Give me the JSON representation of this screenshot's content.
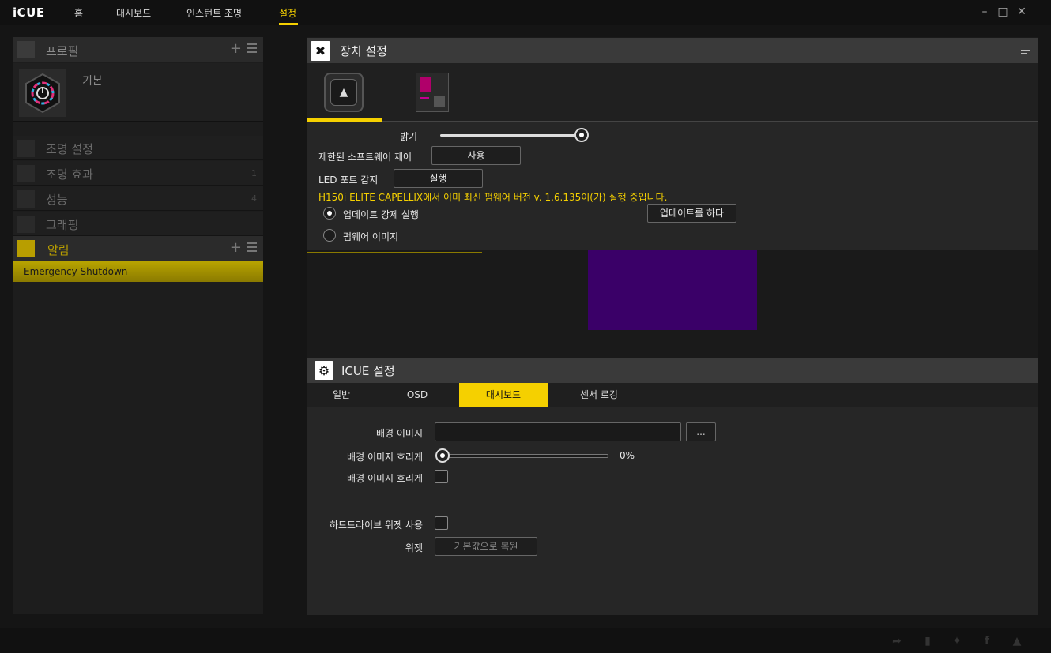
{
  "app": {
    "name": "iCUE"
  },
  "nav": {
    "home": "홈",
    "dashboard": "대시보드",
    "instant_lighting": "인스턴트 조명",
    "settings": "설정"
  },
  "left": {
    "profiles_title": "프로필",
    "profile_name": "기본",
    "lighting_setup": "조명 설정",
    "lighting_effects": "조명 효과",
    "lighting_effects_count": "1",
    "performance": "성능",
    "performance_count": "4",
    "graphing": "그래핑",
    "alerts_title": "알림",
    "alert_item": "Emergency Shutdown"
  },
  "device": {
    "title": "장치 설정",
    "brightness_label": "밝기",
    "brightness_value": 1.0,
    "limited_software_label": "제한된 소프트웨어 제어",
    "limited_software_btn": "사용",
    "led_port_label": "LED 포트 감지",
    "led_port_btn": "실행",
    "firmware_message": "H150i ELITE CAPELLIX에서 이미 최신 펌웨어 버전 v. 1.6.135이(가) 실행 중입니다.",
    "force_update_label": "업데이트 강제 실행",
    "firmware_image_label": "펌웨어 이미지",
    "update_btn": "업데이트를 하다"
  },
  "icue": {
    "title": "ICUE 설정",
    "tabs": [
      "일반",
      "OSD",
      "대시보드",
      "센서 로깅"
    ],
    "active_tab": "대시보드",
    "bg_image_label": "배경 이미지",
    "bg_image_value": "",
    "browse_btn": "...",
    "bg_blur_label": "배경 이미지 흐리게",
    "bg_blur_value": "0%",
    "bg_blur_check_label": "배경 이미지 흐리게",
    "hdd_widget_label": "하드드라이브 위젯 사용",
    "widget_label": "위젯",
    "reset_btn": "기본값으로 복원"
  },
  "colors": {
    "accent": "#f5d000",
    "panel": "#262626",
    "background": "#151515",
    "purple_preview": "#3a0068"
  }
}
